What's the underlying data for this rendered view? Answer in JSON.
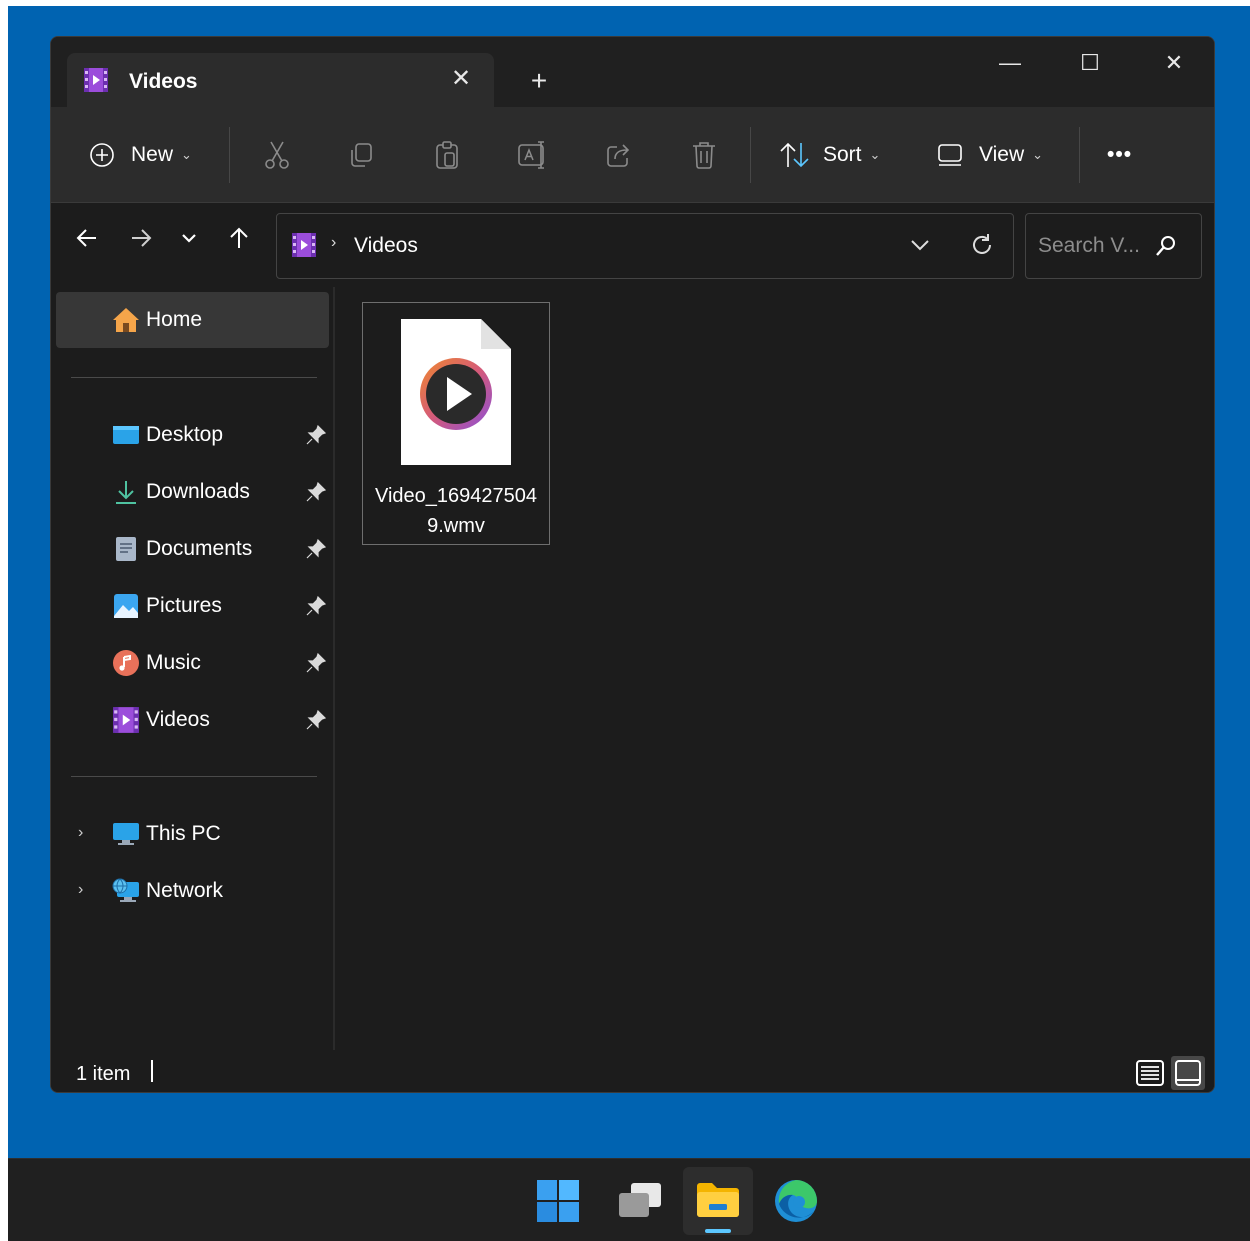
{
  "window": {
    "tab_title": "Videos",
    "controls": {
      "minimize": "—",
      "maximize": "☐",
      "close": "✕",
      "tab_close": "✕",
      "new_tab": "+"
    }
  },
  "toolbar": {
    "new_label": "New",
    "sort_label": "Sort",
    "view_label": "View",
    "more_label": "•••"
  },
  "address": {
    "separator": "›",
    "location": "Videos",
    "search_placeholder": "Search V..."
  },
  "nav": {
    "home": "Home",
    "quick_access": [
      {
        "label": "Desktop"
      },
      {
        "label": "Downloads"
      },
      {
        "label": "Documents"
      },
      {
        "label": "Pictures"
      },
      {
        "label": "Music"
      },
      {
        "label": "Videos"
      }
    ],
    "this_pc": "This PC",
    "network": "Network"
  },
  "content": {
    "files": [
      {
        "name": "Video_1694275049.wmv",
        "icon": "video-file-icon"
      }
    ]
  },
  "status": {
    "item_count": "1 item"
  },
  "colors": {
    "desktop": "#0063b1",
    "window_bg": "#1c1c1c",
    "toolbar_bg": "#2c2c2c",
    "taskbar_bg": "#202020",
    "accent": "#5cc7ff"
  }
}
